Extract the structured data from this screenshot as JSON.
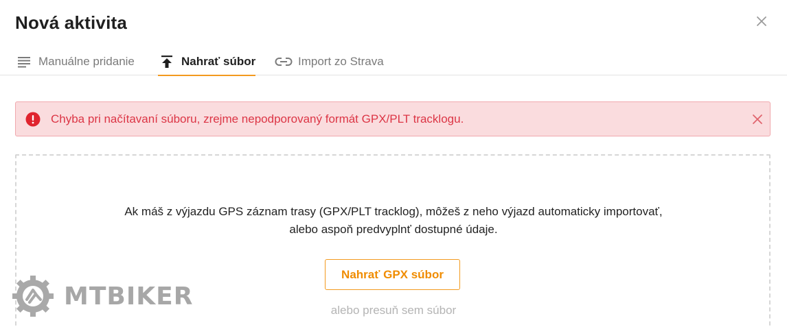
{
  "modal": {
    "title": "Nová aktivita"
  },
  "tabs": [
    {
      "label": "Manuálne pridanie",
      "icon": "list-icon",
      "active": false
    },
    {
      "label": "Nahrať súbor",
      "icon": "upload-icon",
      "active": true
    },
    {
      "label": "Import zo Strava",
      "icon": "link-icon",
      "active": false
    }
  ],
  "alert": {
    "message": "Chyba pri načítavaní súboru, zrejme nepodporovaný formát GPX/PLT tracklogu.",
    "icon": "error-icon",
    "color": "#dc3545"
  },
  "dropzone": {
    "line1": "Ak máš z výjazdu GPS záznam trasy (GPX/PLT tracklog), môžeš z neho výjazd automaticky importovať,",
    "line2": "alebo aspoň predvyplnť dostupné údaje.",
    "button_label": "Nahrať GPX súbor",
    "hint": "alebo presuň sem súbor"
  },
  "watermark": {
    "text": "MTBIKER"
  },
  "colors": {
    "accent": "#f39a1e",
    "error": "#dc3545",
    "error_bg": "#fadcde"
  }
}
